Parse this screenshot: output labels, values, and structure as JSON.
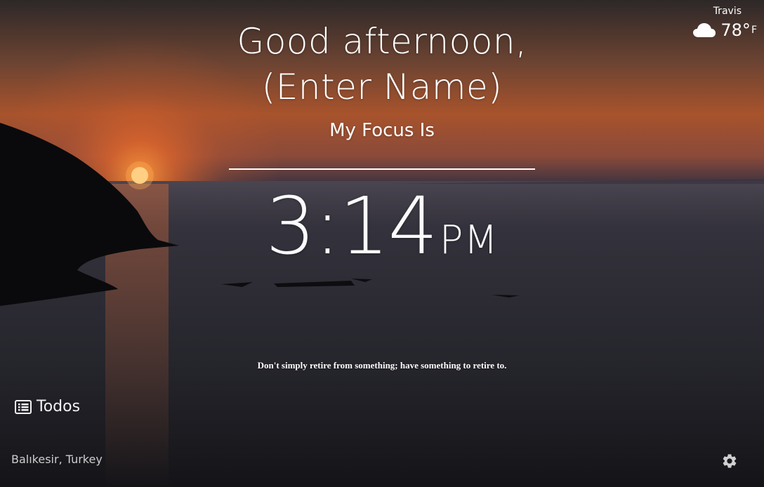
{
  "background": {
    "sky_top": "#2f2a2a",
    "sky_mid": "#b0562b",
    "horizon_glow": "#cf5d24",
    "sun": "#ffdc8a",
    "sea": "#2c2c33",
    "sea_dark": "#15151a",
    "cliff": "#0b0b0e"
  },
  "weather": {
    "location": "Travis",
    "icon": "cloud-icon",
    "temperature": "78°",
    "unit": "F"
  },
  "greeting": {
    "line1": "Good afternoon,",
    "line2": "(Enter Name)"
  },
  "focus": {
    "label": "My Focus Is",
    "value": ""
  },
  "clock": {
    "time": "3:14",
    "period": "PM"
  },
  "quote": {
    "text": "Don't simply retire from something; have something to retire to."
  },
  "todos": {
    "icon": "list-icon",
    "label": "Todos"
  },
  "photo": {
    "location": "Balıkesir, Turkey"
  },
  "settings": {
    "icon": "gear-icon"
  }
}
